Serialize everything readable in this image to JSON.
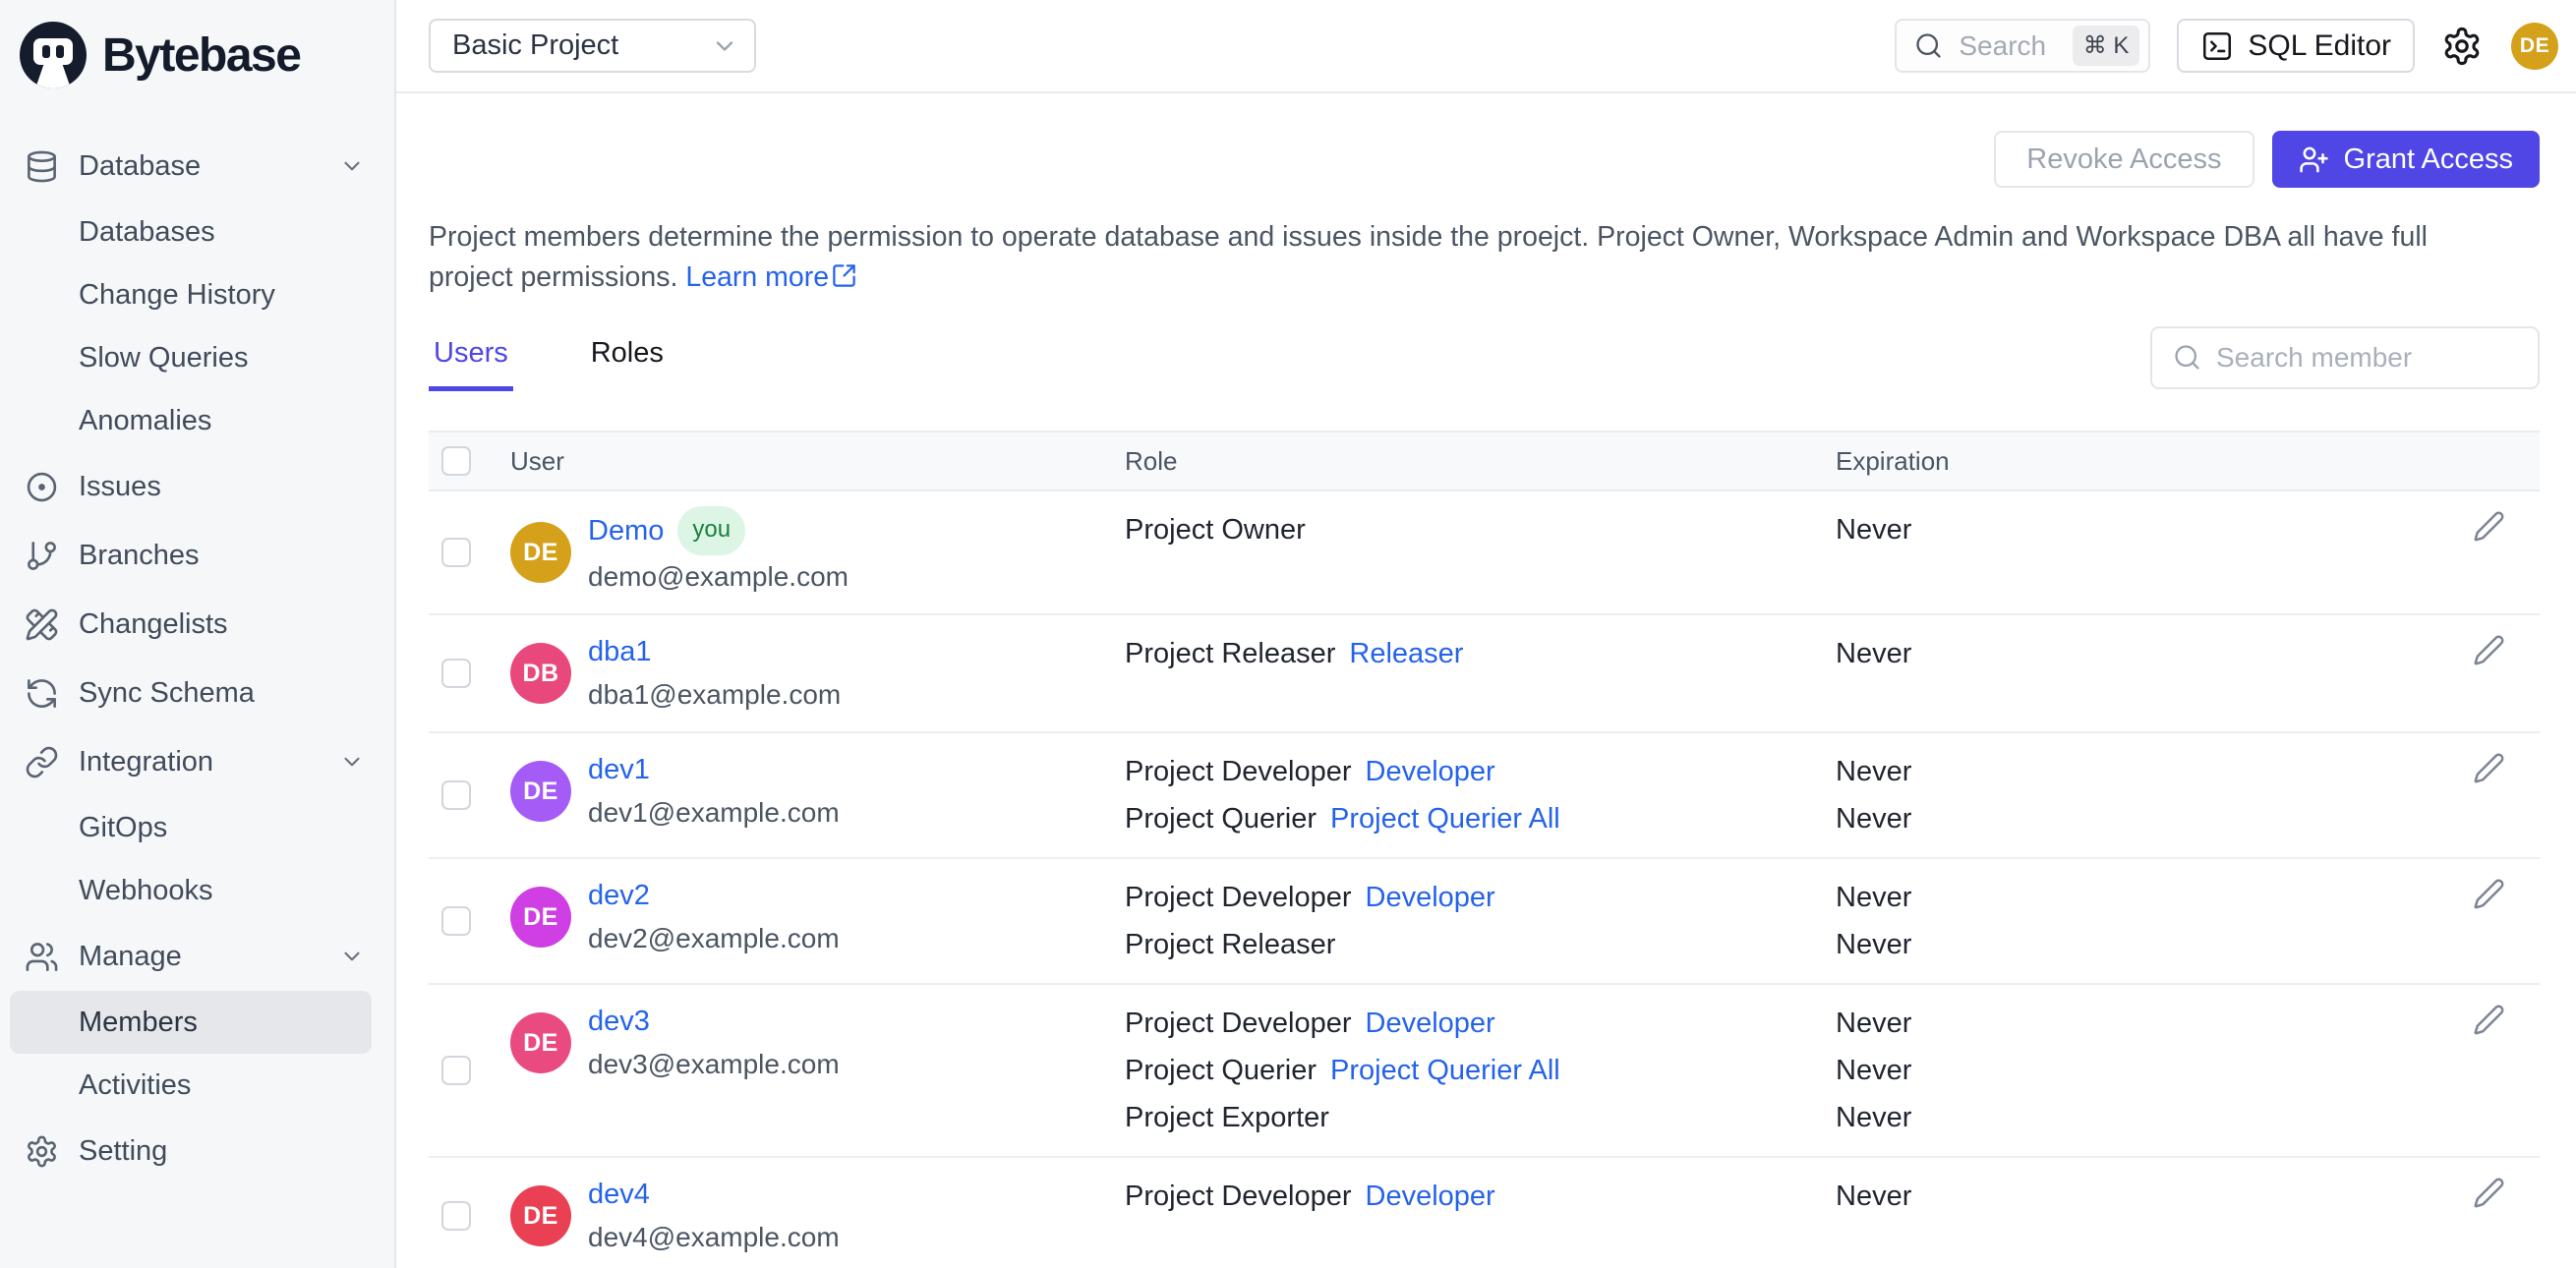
{
  "brand": {
    "name": "Bytebase"
  },
  "colors": {
    "accent": "#4f46e5",
    "link": "#2563eb",
    "topbar_avatar": "#d5a11b"
  },
  "topbar": {
    "project_selector": "Basic Project",
    "search_placeholder": "Search",
    "search_kbd": "⌘ K",
    "sql_editor_label": "SQL Editor",
    "avatar_initials": "DE"
  },
  "sidebar": {
    "items": [
      {
        "label": "Database"
      },
      {
        "label": "Databases"
      },
      {
        "label": "Change History"
      },
      {
        "label": "Slow Queries"
      },
      {
        "label": "Anomalies"
      },
      {
        "label": "Issues"
      },
      {
        "label": "Branches"
      },
      {
        "label": "Changelists"
      },
      {
        "label": "Sync Schema"
      },
      {
        "label": "Integration"
      },
      {
        "label": "GitOps"
      },
      {
        "label": "Webhooks"
      },
      {
        "label": "Manage"
      },
      {
        "label": "Members"
      },
      {
        "label": "Activities"
      },
      {
        "label": "Setting"
      }
    ]
  },
  "page": {
    "revoke_button": "Revoke Access",
    "grant_button": "Grant Access",
    "description": "Project members determine the permission to operate database and issues inside the proejct. Project Owner, Workspace Admin and Workspace DBA all have full project permissions.",
    "learn_more": "Learn more",
    "tabs": [
      {
        "label": "Users"
      },
      {
        "label": "Roles"
      }
    ],
    "member_search_placeholder": "Search member",
    "table": {
      "headers": {
        "user": "User",
        "role": "Role",
        "expiration": "Expiration"
      },
      "rows": [
        {
          "initials": "DE",
          "avatar_color": "#d5a11b",
          "name": "Demo",
          "you_badge": "you",
          "email": "demo@example.com",
          "roles": [
            {
              "role": "Project Owner"
            }
          ],
          "expirations": [
            "Never"
          ]
        },
        {
          "initials": "DB",
          "avatar_color": "#e9487d",
          "name": "dba1",
          "email": "dba1@example.com",
          "roles": [
            {
              "role": "Project Releaser",
              "link": "Releaser"
            }
          ],
          "expirations": [
            "Never"
          ]
        },
        {
          "initials": "DE",
          "avatar_color": "#a55bf5",
          "name": "dev1",
          "email": "dev1@example.com",
          "roles": [
            {
              "role": "Project Developer",
              "link": "Developer"
            },
            {
              "role": "Project Querier",
              "link": "Project Querier All"
            }
          ],
          "expirations": [
            "Never",
            "Never"
          ]
        },
        {
          "initials": "DE",
          "avatar_color": "#cf3fe3",
          "name": "dev2",
          "email": "dev2@example.com",
          "roles": [
            {
              "role": "Project Developer",
              "link": "Developer"
            },
            {
              "role": "Project Releaser"
            }
          ],
          "expirations": [
            "Never",
            "Never"
          ]
        },
        {
          "initials": "DE",
          "avatar_color": "#e94b80",
          "name": "dev3",
          "email": "dev3@example.com",
          "roles": [
            {
              "role": "Project Developer",
              "link": "Developer"
            },
            {
              "role": "Project Querier",
              "link": "Project Querier All"
            },
            {
              "role": "Project Exporter"
            }
          ],
          "expirations": [
            "Never",
            "Never",
            "Never"
          ]
        },
        {
          "initials": "DE",
          "avatar_color": "#ea4053",
          "name": "dev4",
          "email": "dev4@example.com",
          "roles": [
            {
              "role": "Project Developer",
              "link": "Developer"
            }
          ],
          "expirations": [
            "Never"
          ]
        }
      ]
    }
  }
}
